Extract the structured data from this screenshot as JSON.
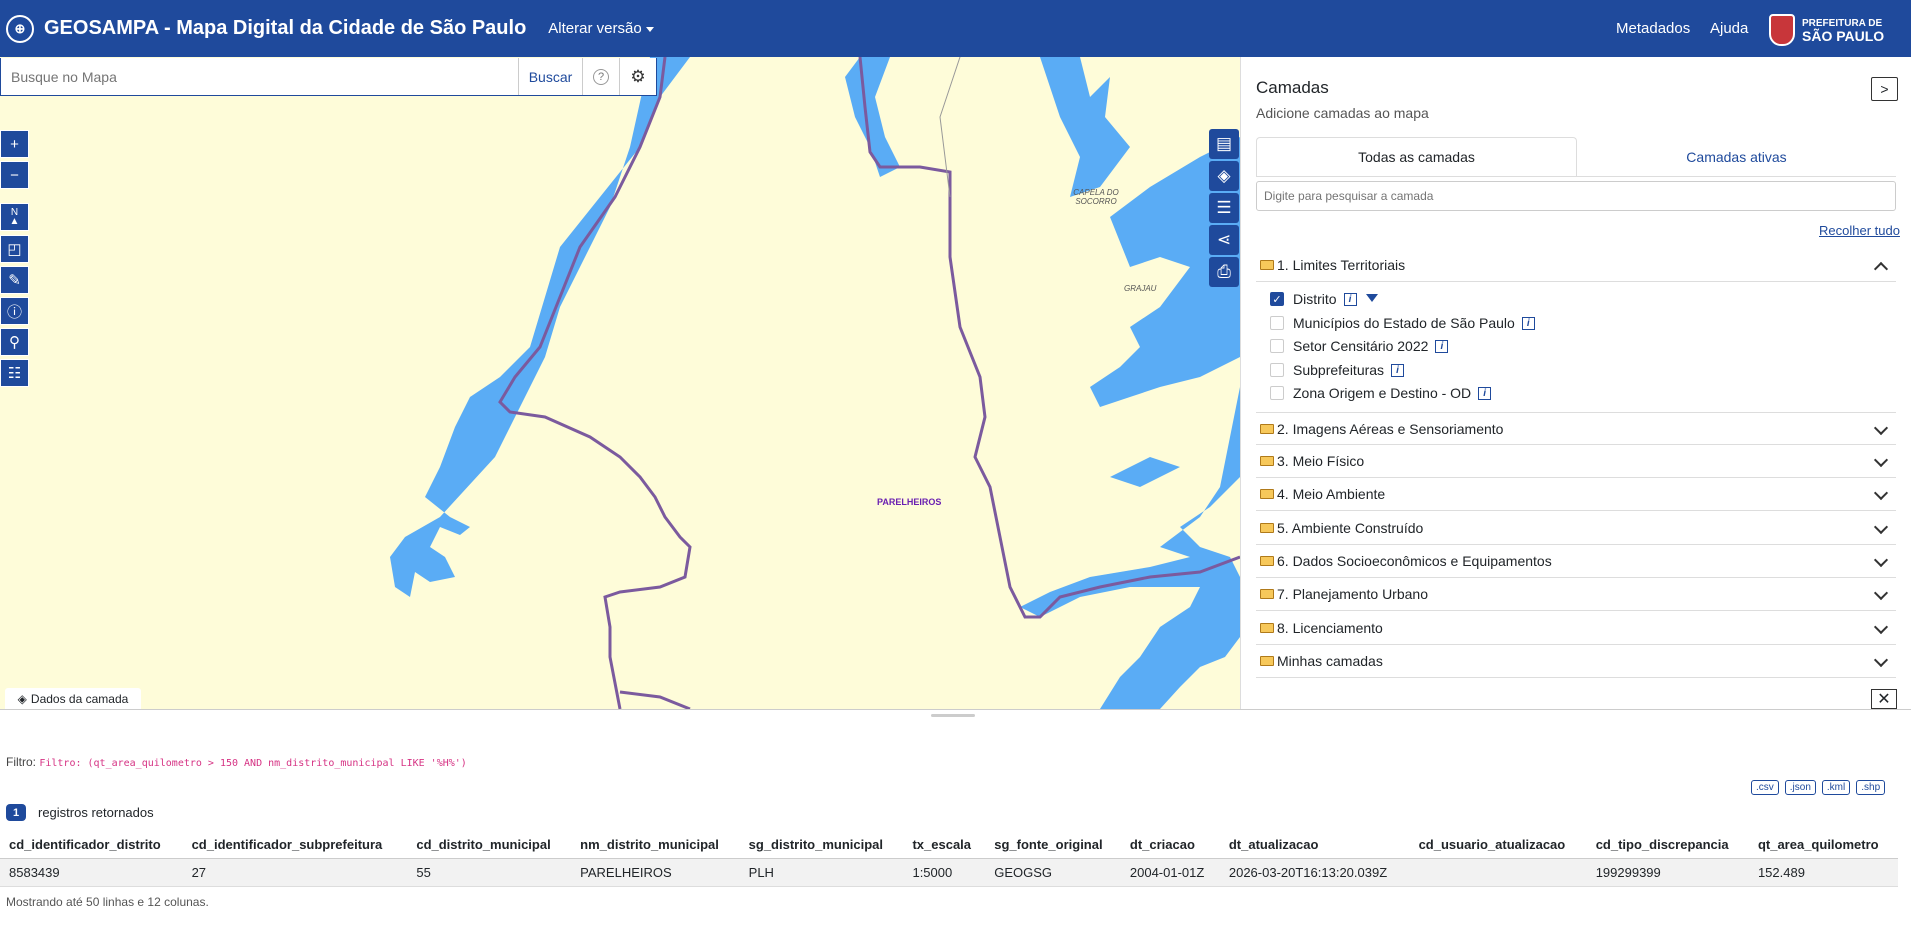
{
  "header": {
    "title": "GEOSAMPA - Mapa Digital da Cidade de São Paulo",
    "version_label": "Alterar versão",
    "nav": [
      "Metadados",
      "Ajuda"
    ],
    "prefeitura_line1": "PREFEITURA DE",
    "prefeitura_line2": "SÃO PAULO"
  },
  "search": {
    "placeholder": "Busque no Mapa",
    "button": "Buscar"
  },
  "map": {
    "zoom_in": "+",
    "zoom_out": "−",
    "labels": [
      "CAPELA DO SOCORRO",
      "GRAJAU",
      "PARELHEIROS"
    ],
    "water_color": "#5aacf5",
    "land_color": "#fefcd9",
    "boundary_color": "#7b5a9e",
    "data_tab": "Dados da camada"
  },
  "panel": {
    "title": "Camadas",
    "subtitle": "Adicione camadas ao mapa",
    "tabs": [
      "Todas as camadas",
      "Camadas ativas"
    ],
    "search_placeholder": "Digite para pesquisar a camada",
    "collapse_all": "Recolher tudo",
    "categories": [
      "1. Limites Territoriais",
      "2. Imagens Aéreas e Sensoriamento",
      "3. Meio Físico",
      "4. Meio Ambiente",
      "5. Ambiente Construído",
      "6. Dados Socioeconômicos e Equipamentos",
      "7. Planejamento Urbano",
      "8. Licenciamento",
      "Minhas camadas"
    ],
    "sublayers": [
      {
        "label": "Distrito",
        "checked": true,
        "filter": "filled"
      },
      {
        "label": "Municípios do Estado de São Paulo",
        "checked": false,
        "filter": "none"
      },
      {
        "label": "Setor Censitário 2022",
        "checked": false,
        "filter": "outline"
      },
      {
        "label": "Subprefeituras",
        "checked": false,
        "filter": "outline"
      },
      {
        "label": "Zona Origem e Destino - OD",
        "checked": false,
        "filter": "outline"
      }
    ]
  },
  "bottom": {
    "filter_label": "Filtro:",
    "filter_expr": "Filtro: (qt_area_quilometro > 150 AND nm_distrito_municipal LIKE '%H%')",
    "exports": [
      ".csv",
      ".json",
      ".kml",
      ".shp"
    ],
    "count": "1",
    "count_label": "registros retornados",
    "columns": [
      "cd_identificador_distrito",
      "cd_identificador_subprefeitura",
      "cd_distrito_municipal",
      "nm_distrito_municipal",
      "sg_distrito_municipal",
      "tx_escala",
      "sg_fonte_original",
      "dt_criacao",
      "dt_atualizacao",
      "cd_usuario_atualizacao",
      "cd_tipo_discrepancia",
      "qt_area_quilometro"
    ],
    "rows": [
      [
        "8583439",
        "27",
        "55",
        "PARELHEIROS",
        "PLH",
        "1:5000",
        "GEOGSG",
        "2004-01-01Z",
        "2026-03-20T16:13:20.039Z",
        "",
        "199299399",
        "152.489"
      ]
    ],
    "footnote": "Mostrando até 50 linhas e 12 colunas."
  }
}
